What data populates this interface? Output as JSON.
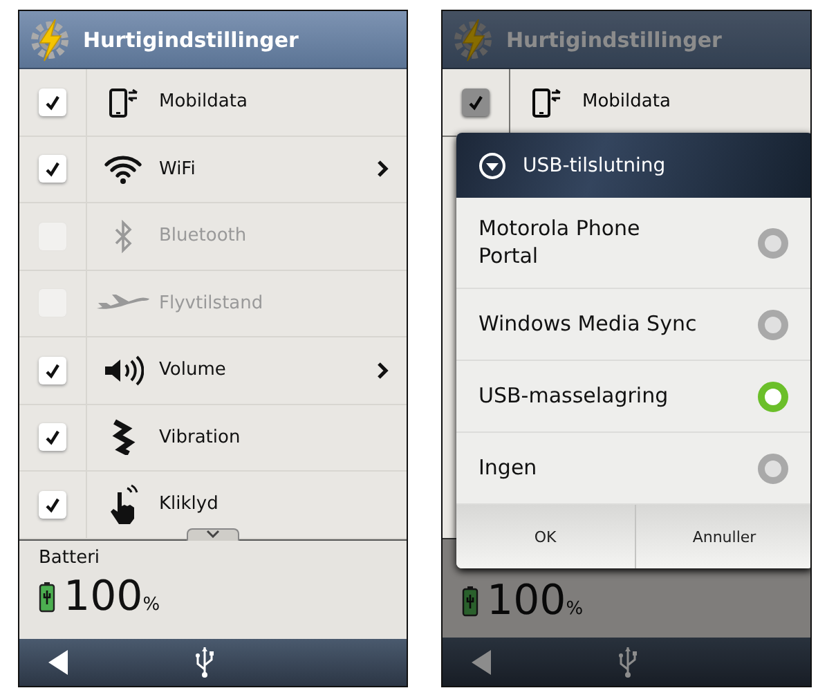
{
  "left_screen": {
    "title": "Hurtigindstillinger",
    "toggles": [
      {
        "kind": "mobile-data",
        "label": "Mobildata",
        "checked": true,
        "disabled": false,
        "chevron": false
      },
      {
        "kind": "wifi",
        "label": "WiFi",
        "checked": true,
        "disabled": false,
        "chevron": true
      },
      {
        "kind": "bluetooth",
        "label": "Bluetooth",
        "checked": false,
        "disabled": true,
        "chevron": false
      },
      {
        "kind": "airplane",
        "label": "Flyvtilstand",
        "checked": false,
        "disabled": true,
        "chevron": false
      },
      {
        "kind": "volume",
        "label": "Volume",
        "checked": true,
        "disabled": false,
        "chevron": true
      },
      {
        "kind": "vibration",
        "label": "Vibration",
        "checked": true,
        "disabled": false,
        "chevron": false
      },
      {
        "kind": "touch",
        "label": "Kliklyd",
        "checked": true,
        "disabled": false,
        "chevron": false
      }
    ],
    "battery": {
      "label": "Batteri",
      "value": "100",
      "unit": "%"
    }
  },
  "right_screen": {
    "title": "Hurtigindstillinger",
    "toggles": [
      {
        "kind": "mobile-data",
        "label": "Mobildata",
        "checked": true,
        "disabled": false,
        "chevron": false
      }
    ],
    "battery": {
      "value": "100",
      "unit": "%"
    },
    "dialog": {
      "title": "USB-tilslutning",
      "options": [
        {
          "label": "Motorola Phone Portal",
          "selected": false
        },
        {
          "label": "Windows Media Sync",
          "selected": false
        },
        {
          "label": "USB-masselagring",
          "selected": true
        },
        {
          "label": "Ingen",
          "selected": false
        }
      ],
      "buttons": [
        "OK",
        "Annuller"
      ]
    }
  }
}
